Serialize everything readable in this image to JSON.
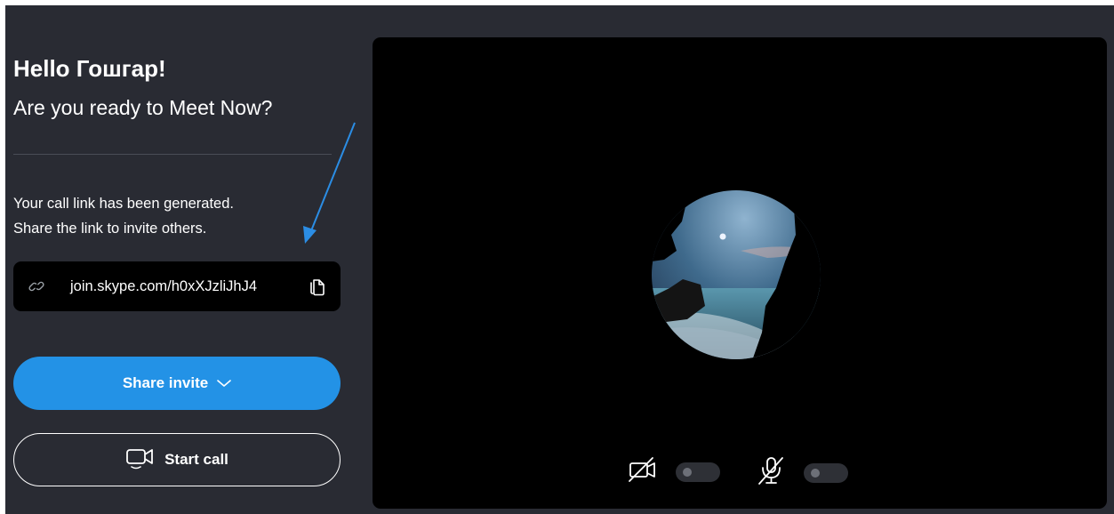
{
  "greeting": "Hello Гошгар!",
  "subtitle": "Are you ready to Meet Now?",
  "message": {
    "line1": "Your call link has been generated.",
    "line2": "Share the link to invite others."
  },
  "link": {
    "url": "join.skype.com/h0xXJzliJhJ4",
    "icon": "link-icon",
    "copy_icon": "copy-icon"
  },
  "buttons": {
    "share_invite": "Share invite",
    "start_call": "Start call"
  },
  "preview": {
    "video_toggle": {
      "icon": "video-off-icon",
      "state": "off"
    },
    "mic_toggle": {
      "icon": "mic-off-icon",
      "state": "off"
    }
  },
  "colors": {
    "panel_bg": "#292b33",
    "accent": "#2392e6",
    "preview_bg": "#000000",
    "annotation_arrow": "#2b8de4"
  }
}
